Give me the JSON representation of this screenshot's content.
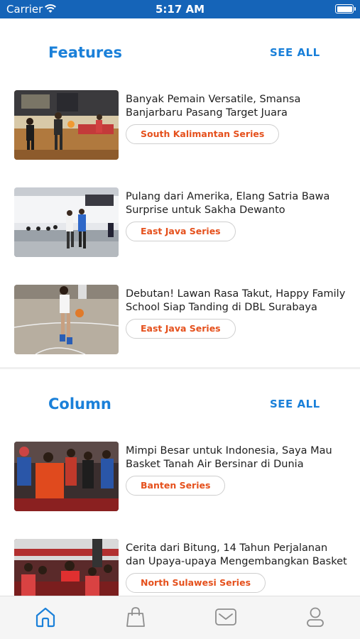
{
  "status_bar": {
    "carrier": "Carrier",
    "time": "5:17 AM"
  },
  "sections": [
    {
      "title": "Features",
      "see_all": "SEE ALL",
      "articles": [
        {
          "headline": "Banyak Pemain Versatile, Smansa Banjarbaru Pasang Target Juara",
          "tag": "South Kalimantan Series",
          "image": "basketball-game-photo"
        },
        {
          "headline": "Pulang dari Amerika, Elang Satria Bawa Surprise untuk Sakha Dewanto",
          "tag": "East Java Series",
          "image": "basketball-gym-photo"
        },
        {
          "headline": "Debutan! Lawan Rasa Takut, Happy Family School Siap Tanding di DBL Surabaya",
          "tag": "East Java Series",
          "image": "basketball-dribble-photo"
        }
      ]
    },
    {
      "title": "Column",
      "see_all": "SEE ALL",
      "articles": [
        {
          "headline": "Mimpi Besar untuk Indonesia, Saya Mau Basket Tanah Air Bersinar di Dunia",
          "tag": "Banten Series",
          "image": "team-huddle-photo"
        },
        {
          "headline": "Cerita dari Bitung, 14 Tahun Perjalanan dan Upaya-upaya Mengembangkan Basket",
          "tag": "North Sulawesi Series",
          "image": "crowd-event-photo"
        }
      ]
    }
  ],
  "tab_bar": {
    "tabs": [
      {
        "icon": "home-icon",
        "active": true
      },
      {
        "icon": "shopping-bag-icon",
        "active": false
      },
      {
        "icon": "mail-icon",
        "active": false
      },
      {
        "icon": "profile-icon",
        "active": false
      }
    ],
    "active_color": "#1a80d9",
    "inactive_color": "#8e8e8e"
  },
  "colors": {
    "status_bar": "#1564b8",
    "accent": "#1a80d9",
    "tag_text": "#e5501c"
  }
}
